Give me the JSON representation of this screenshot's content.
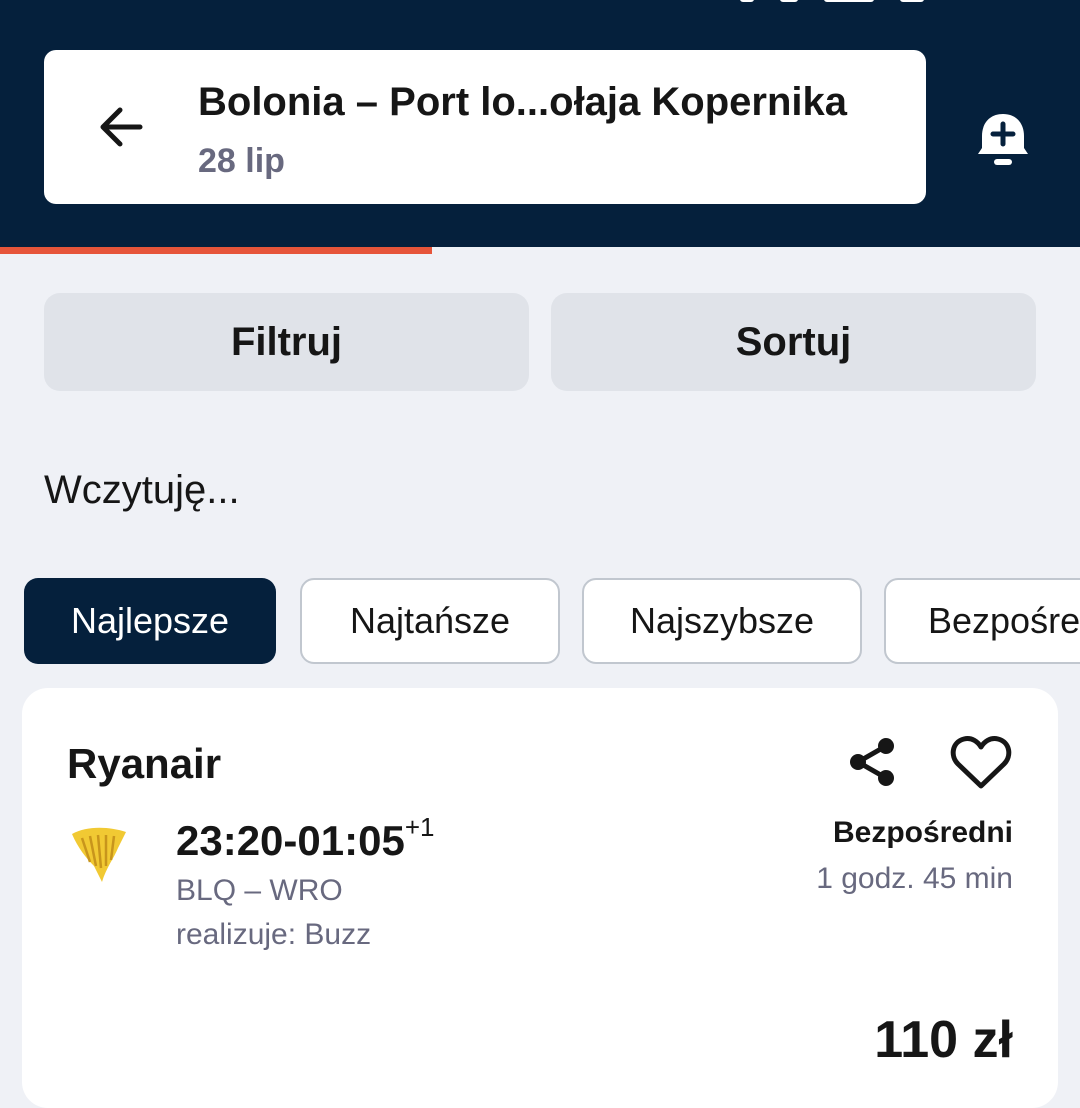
{
  "header": {
    "route_title": "Bolonia – Port lo...ołaja Kopernika",
    "date": "28 lip",
    "search_progress": 0.4
  },
  "toolbar": {
    "filter_label": "Filtruj",
    "sort_label": "Sortuj"
  },
  "status": {
    "loading_text": "Wczytuję..."
  },
  "tabs": [
    {
      "label": "Najlepsze",
      "active": true
    },
    {
      "label": "Najtańsze",
      "active": false
    },
    {
      "label": "Najszybsze",
      "active": false
    },
    {
      "label": "Bezpośre",
      "active": false
    }
  ],
  "result": {
    "airline": "Ryanair",
    "times": "23:20-01:05",
    "day_offset": "+1",
    "route": "BLQ – WRO",
    "operated_by": "realizuje: Buzz",
    "stops": "Bezpośredni",
    "duration": "1 godz. 45 min",
    "price": "110 zł"
  },
  "icons": {
    "back": "arrow-left-icon",
    "price_alert": "bell-plus-icon",
    "share": "share-icon",
    "favorite": "heart-icon",
    "airline_logo": "ryanair-harp-logo"
  },
  "colors": {
    "header_bg": "#05203c",
    "accent": "#e6553a",
    "page_bg": "#eff1f6",
    "logo_yellow": "#f1c933"
  }
}
